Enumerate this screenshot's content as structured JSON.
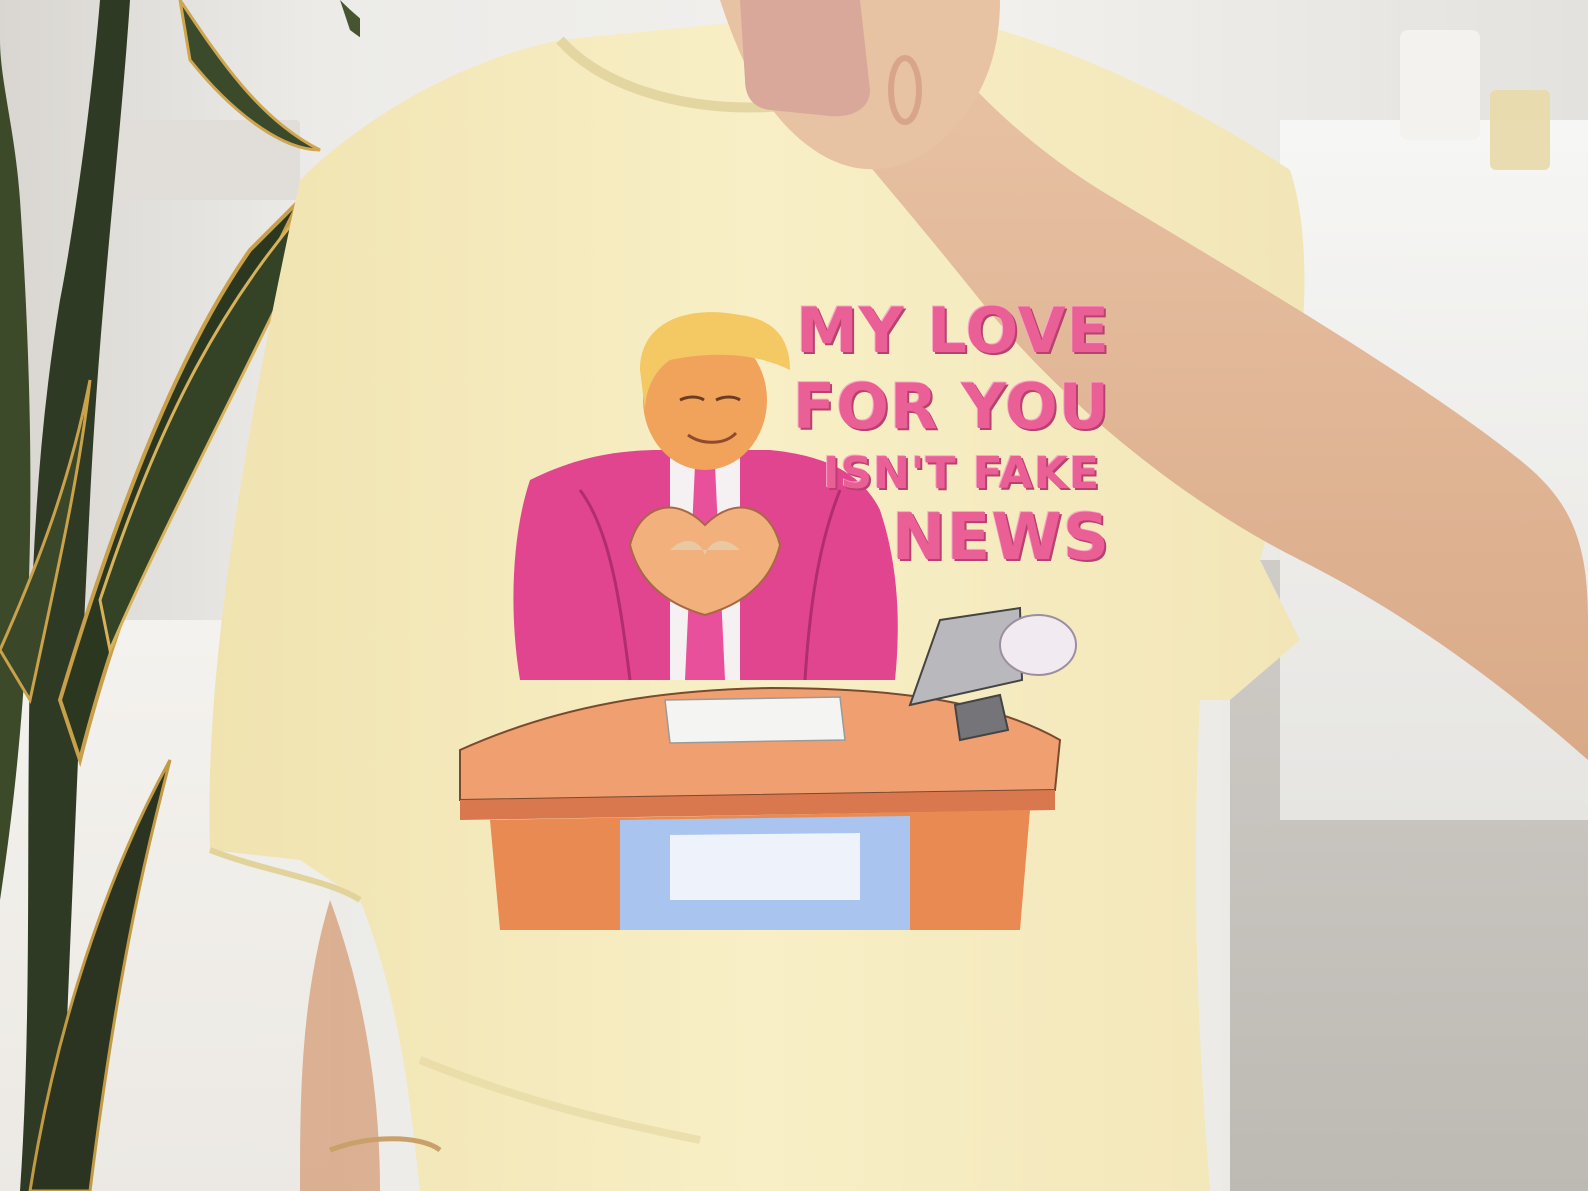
{
  "image": {
    "subject": "t-shirt-mockup",
    "shirt_color": "#f7eec0",
    "print_accent_color": "#ea5f96"
  },
  "print": {
    "lines": [
      "MY LOVE",
      "FOR YOU",
      "ISN'T FAKE",
      "NEWS"
    ]
  }
}
